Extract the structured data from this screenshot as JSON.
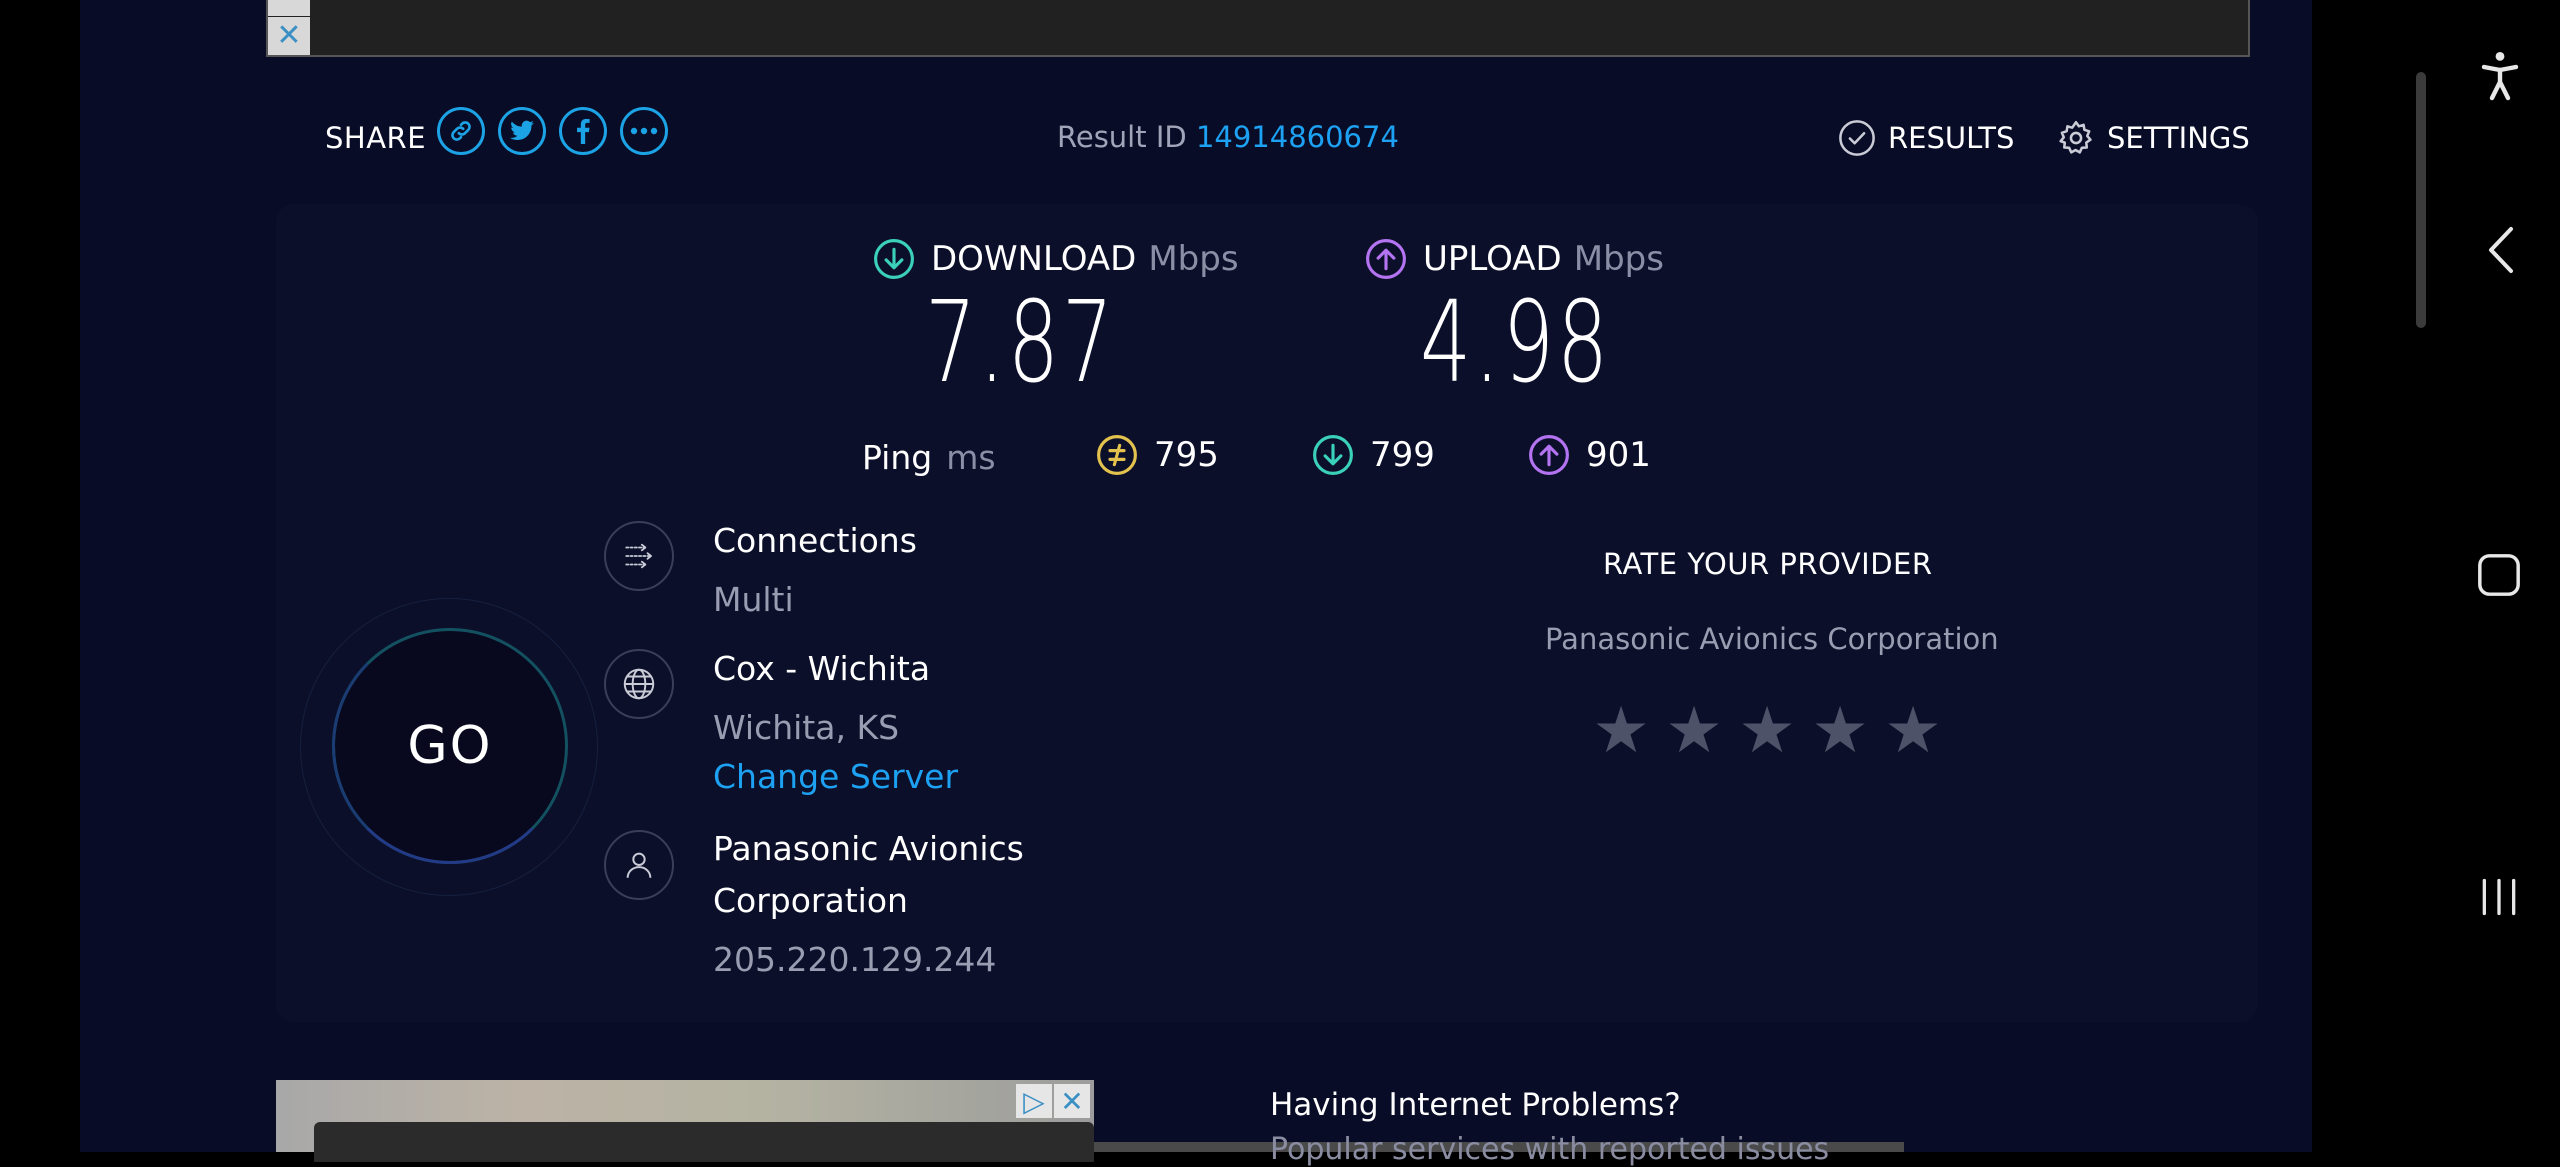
{
  "share": {
    "label": "SHARE",
    "icons": [
      "link-icon",
      "twitter-icon",
      "facebook-icon",
      "more-icon"
    ]
  },
  "result": {
    "label": "Result ID",
    "id": "14914860674"
  },
  "nav": {
    "results": "RESULTS",
    "settings": "SETTINGS"
  },
  "download": {
    "label": "DOWNLOAD",
    "unit": "Mbps",
    "value": "7.87"
  },
  "upload": {
    "label": "UPLOAD",
    "unit": "Mbps",
    "value": "4.98"
  },
  "ping": {
    "label": "Ping",
    "unit": "ms",
    "idle": "795",
    "download": "799",
    "upload": "901"
  },
  "go": {
    "label": "GO"
  },
  "connections": {
    "title": "Connections",
    "value": "Multi"
  },
  "server": {
    "title": "Cox - Wichita",
    "location": "Wichita, KS",
    "change": "Change Server"
  },
  "provider": {
    "title_line1": "Panasonic Avionics",
    "title_line2": "Corporation",
    "ip": "205.220.129.244"
  },
  "rate": {
    "title": "RATE YOUR PROVIDER",
    "provider": "Panasonic Avionics Corporation",
    "stars_total": 5,
    "stars_selected": 0
  },
  "promo": {
    "title": "Having Internet Problems?",
    "subtitle": "Popular services with reported issues"
  },
  "colors": {
    "accent": "#1da1f2",
    "download": "#3ad1b8",
    "upload": "#b474f2",
    "ping": "#e3c24d",
    "background": "#090c26"
  }
}
